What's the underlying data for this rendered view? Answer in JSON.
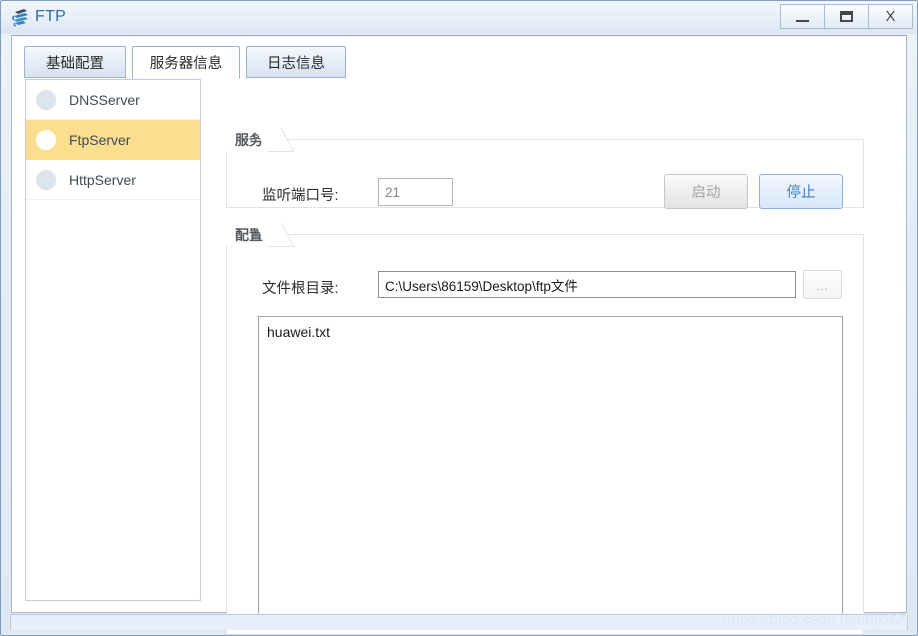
{
  "window": {
    "title": "FTP",
    "icon": "ftp-app-icon",
    "controls": {
      "minimize": "minimize-icon",
      "maximize": "maximize-icon",
      "close": "X"
    }
  },
  "tabs": [
    {
      "label": "基础配置",
      "selected": false
    },
    {
      "label": "服务器信息",
      "selected": true
    },
    {
      "label": "日志信息",
      "selected": false
    }
  ],
  "sidebar": {
    "items": [
      {
        "label": "DNSServer",
        "selected": false
      },
      {
        "label": "FtpServer",
        "selected": true
      },
      {
        "label": "HttpServer",
        "selected": false
      }
    ]
  },
  "service_group": {
    "title": "服务",
    "port_label": "监听端口号:",
    "port_value": "21",
    "port_placeholder": "",
    "start_button": "启动",
    "stop_button": "停止"
  },
  "config_group": {
    "title": "配置",
    "dir_label": "文件根目录:",
    "dir_value": "C:\\Users\\86159\\Desktop\\ftp文件",
    "dir_placeholder": "",
    "browse_button": "...",
    "files": [
      "huawei.txt"
    ]
  },
  "statusbar": {
    "watermark": "https://blog.csdn.net/hjx020"
  },
  "colors": {
    "title_text": "#2f6aa8",
    "selected_row": "#fbdf8f",
    "stop_button_text": "#3f7fc4",
    "disabled_text": "#a5a5a5"
  }
}
